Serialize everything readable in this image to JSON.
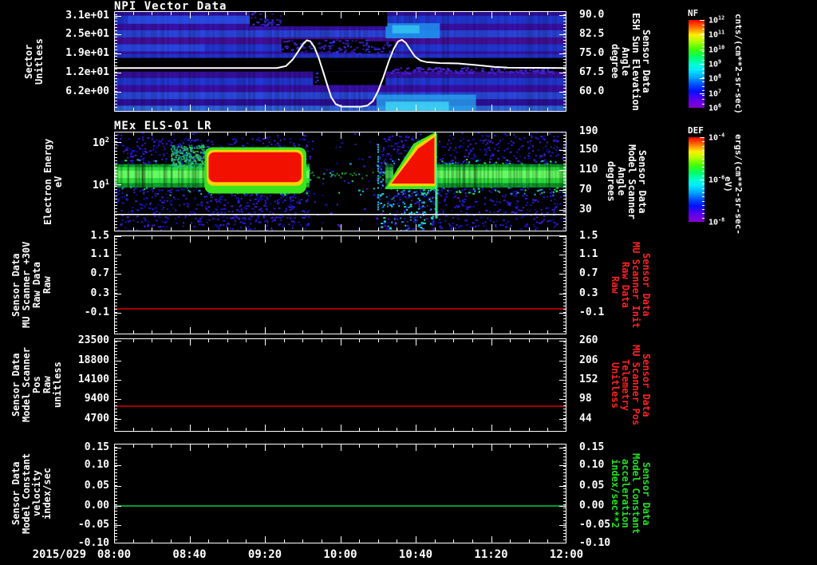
{
  "x_axis": {
    "date": "2015/029",
    "ticks": [
      "08:00",
      "08:40",
      "09:20",
      "10:00",
      "10:40",
      "11:20",
      "12:00"
    ],
    "minor_per_major": 3,
    "range": "08:00 to 12:00"
  },
  "chart_data": [
    {
      "type": "heatmap",
      "title": "NPI Vector Data",
      "left_axis": {
        "label": "Sector\nUnitless",
        "ticks": [
          "3.1e+01",
          "2.5e+01",
          "1.9e+01",
          "1.2e+01",
          "6.2e+00"
        ],
        "tick_fracs": [
          0.048,
          0.23,
          0.42,
          0.61,
          0.8
        ]
      },
      "right_axis": {
        "label": "Sensor Data\nESH Sun Elevation\nAngle\ndegree",
        "color": "#ffffff",
        "ticks": [
          "90.0",
          "82.5",
          "75.0",
          "67.5",
          "60.0"
        ],
        "tick_fracs": [
          0.04,
          0.23,
          0.42,
          0.61,
          0.8
        ]
      },
      "colorbar": {
        "title": "NF",
        "ticks": [
          "10^12",
          "10^11",
          "10^10",
          "10^9",
          "10^8",
          "10^7",
          "10^6"
        ],
        "units": "cnts/(cm**2-sr-sec)"
      },
      "bands": [
        [
          0.0,
          0.045,
          "#30109c"
        ],
        [
          0.045,
          0.125,
          "#2238d8"
        ],
        [
          0.125,
          0.19,
          "#3b10ac"
        ],
        [
          0.19,
          0.26,
          "#2a46de"
        ],
        [
          0.26,
          0.33,
          "#45109e"
        ],
        [
          0.33,
          0.4,
          "#2238d8"
        ],
        [
          0.4,
          0.425,
          "#3b10ac"
        ],
        [
          0.425,
          0.465,
          "#2334cf"
        ],
        [
          0.465,
          0.6,
          "#000000"
        ],
        [
          0.6,
          0.665,
          "#36109e"
        ],
        [
          0.665,
          0.735,
          "#2238d8"
        ],
        [
          0.735,
          0.805,
          "#3b10ac"
        ],
        [
          0.805,
          0.875,
          "#2a4ae0"
        ],
        [
          0.875,
          0.94,
          "#2e109e"
        ],
        [
          0.94,
          1.0,
          "#2f66e6"
        ]
      ],
      "highlights": [
        [
          0.03,
          0.36,
          0.045,
          0.125,
          "#2f5aec",
          0.55
        ],
        [
          0.0,
          0.2,
          0.33,
          0.4,
          "#2f5aec",
          0.4
        ],
        [
          0.6,
          0.72,
          0.12,
          0.27,
          "#1f93ee",
          0.85
        ],
        [
          0.615,
          0.675,
          0.14,
          0.22,
          "#35c8f2",
          0.8
        ],
        [
          0.58,
          0.8,
          0.83,
          0.99,
          "#27a9f0",
          0.75
        ],
        [
          0.6,
          0.74,
          0.9,
          0.99,
          "#3fd4f4",
          0.85
        ]
      ],
      "dark_patches": [
        [
          0.3,
          0.37,
          0.0,
          0.15,
          true
        ],
        [
          0.37,
          0.604,
          0.0,
          0.15,
          false
        ],
        [
          0.37,
          0.56,
          0.28,
          0.41,
          true
        ],
        [
          0.52,
          0.62,
          0.3,
          0.42,
          true
        ],
        [
          0.44,
          0.47,
          0.6,
          0.735,
          true
        ],
        [
          0.452,
          0.6,
          0.6,
          0.735,
          false
        ]
      ],
      "speckle_zone": [
        0.61,
        0.97,
        0.555,
        0.615
      ],
      "overlay_line": {
        "name": "ESH Sun Elevation Angle",
        "color": "#ffffff",
        "points": [
          [
            0,
            0.565
          ],
          [
            0.36,
            0.565
          ],
          [
            0.38,
            0.545
          ],
          [
            0.395,
            0.48
          ],
          [
            0.407,
            0.4
          ],
          [
            0.418,
            0.325
          ],
          [
            0.426,
            0.29
          ],
          [
            0.434,
            0.3
          ],
          [
            0.443,
            0.36
          ],
          [
            0.452,
            0.46
          ],
          [
            0.462,
            0.6
          ],
          [
            0.472,
            0.745
          ],
          [
            0.48,
            0.855
          ],
          [
            0.49,
            0.925
          ],
          [
            0.503,
            0.948
          ],
          [
            0.545,
            0.95
          ],
          [
            0.56,
            0.938
          ],
          [
            0.572,
            0.895
          ],
          [
            0.583,
            0.8
          ],
          [
            0.595,
            0.66
          ],
          [
            0.607,
            0.5
          ],
          [
            0.618,
            0.375
          ],
          [
            0.628,
            0.3
          ],
          [
            0.636,
            0.285
          ],
          [
            0.645,
            0.315
          ],
          [
            0.655,
            0.385
          ],
          [
            0.665,
            0.45
          ],
          [
            0.677,
            0.49
          ],
          [
            0.69,
            0.505
          ],
          [
            0.72,
            0.515
          ],
          [
            0.76,
            0.52
          ],
          [
            0.8,
            0.535
          ],
          [
            0.84,
            0.553
          ],
          [
            0.87,
            0.562
          ],
          [
            1.0,
            0.565
          ]
        ]
      }
    },
    {
      "type": "heatmap",
      "title": "MEx ELS-01 LR",
      "left_axis": {
        "label": "Electron Energy\neV",
        "ticks": [
          "10^2",
          "10^1"
        ],
        "tick_fracs": [
          0.104,
          0.528
        ]
      },
      "right_axis": {
        "label": "Sensor Data\nModel Scanner\nAngle\ndegrees",
        "color": "#ffffff",
        "ticks": [
          "190",
          "150",
          "110",
          "70",
          "30"
        ],
        "tick_fracs": [
          0.0,
          0.18,
          0.38,
          0.58,
          0.78
        ]
      },
      "colorbar": {
        "title": "DEF",
        "ticks": [
          "10^-4",
          "10^-6",
          "10^-8"
        ],
        "units": "ergs/(cm**2-sr-sec-eV)"
      },
      "features": {
        "band_spans": [
          [
            0.0,
            0.432,
            1.0
          ],
          [
            0.6,
            0.617,
            0.6
          ],
          [
            0.712,
            1.0,
            1.0
          ]
        ],
        "band_y": [
          0.325,
          0.56
        ],
        "gap_x": [
          0.432,
          0.578
        ],
        "blob1": {
          "x0": 0.2,
          "x1": 0.425,
          "y0": 0.155,
          "y1": 0.62
        },
        "wedge": {
          "base_y": 0.515,
          "x0": 0.618,
          "x1": 0.71,
          "apex_x": 0.695,
          "apex_y": 0.035
        },
        "streak_x": 0.582,
        "white_line_y": 0.824
      }
    },
    {
      "type": "line",
      "title": "",
      "left_axis": {
        "label": "Sensor Data\nMU Scanner +30V\nRaw Data\nRaw",
        "ticks": [
          "1.5",
          "1.1",
          "0.7",
          "0.3",
          "-0.1"
        ],
        "tick_fracs": [
          0.006,
          0.19,
          0.387,
          0.59,
          0.78
        ]
      },
      "right_axis": {
        "label": "Sensor Data\nMU Scanner Init\nRaw Data\nRaw",
        "color": "#ff2222",
        "ticks": [
          "1.5",
          "1.1",
          "0.7",
          "0.3",
          "-0.1"
        ],
        "tick_fracs": [
          0.006,
          0.19,
          0.387,
          0.59,
          0.78
        ]
      },
      "line": {
        "color": "#dd0000",
        "y_frac": 0.742,
        "value": 0.0
      }
    },
    {
      "type": "line",
      "title": "",
      "left_axis": {
        "label": "Sensor Data\nModel Scanner Pos\nRaw\nunitless",
        "ticks": [
          "23500",
          "18800",
          "14100",
          "9400",
          "4700"
        ],
        "tick_fracs": [
          0.026,
          0.24,
          0.445,
          0.65,
          0.863
        ]
      },
      "right_axis": {
        "label": "Sensor Data\nMU Scanner Pos\nTelemetry\nUnitless",
        "color": "#ff2222",
        "ticks": [
          "260",
          "206",
          "152",
          "98",
          "44"
        ],
        "tick_fracs": [
          0.026,
          0.24,
          0.445,
          0.65,
          0.863
        ]
      },
      "line": {
        "color": "#dd0000",
        "y_frac": 0.727,
        "value": 7700
      }
    },
    {
      "type": "line",
      "title": "",
      "left_axis": {
        "label": "Sensor Data\nModel Constant\nvelocity\nindex/sec",
        "ticks": [
          "0.15",
          "0.10",
          "0.05",
          "0.00",
          "-0.05",
          "-0.10"
        ],
        "tick_fracs": [
          0.04,
          0.216,
          0.424,
          0.624,
          0.816,
          1.0
        ]
      },
      "right_axis": {
        "label": "Sensor Data\nModel Constant\nacceleration\nindex/sec**2",
        "color": "#22e022",
        "ticks": [
          "0.15",
          "0.10",
          "0.05",
          "0.00",
          "-0.05",
          "-0.10"
        ],
        "tick_fracs": [
          0.04,
          0.216,
          0.424,
          0.624,
          0.816,
          1.0
        ]
      },
      "line": {
        "color": "#00cc44",
        "y_frac": 0.624,
        "value": 0.0
      }
    }
  ]
}
